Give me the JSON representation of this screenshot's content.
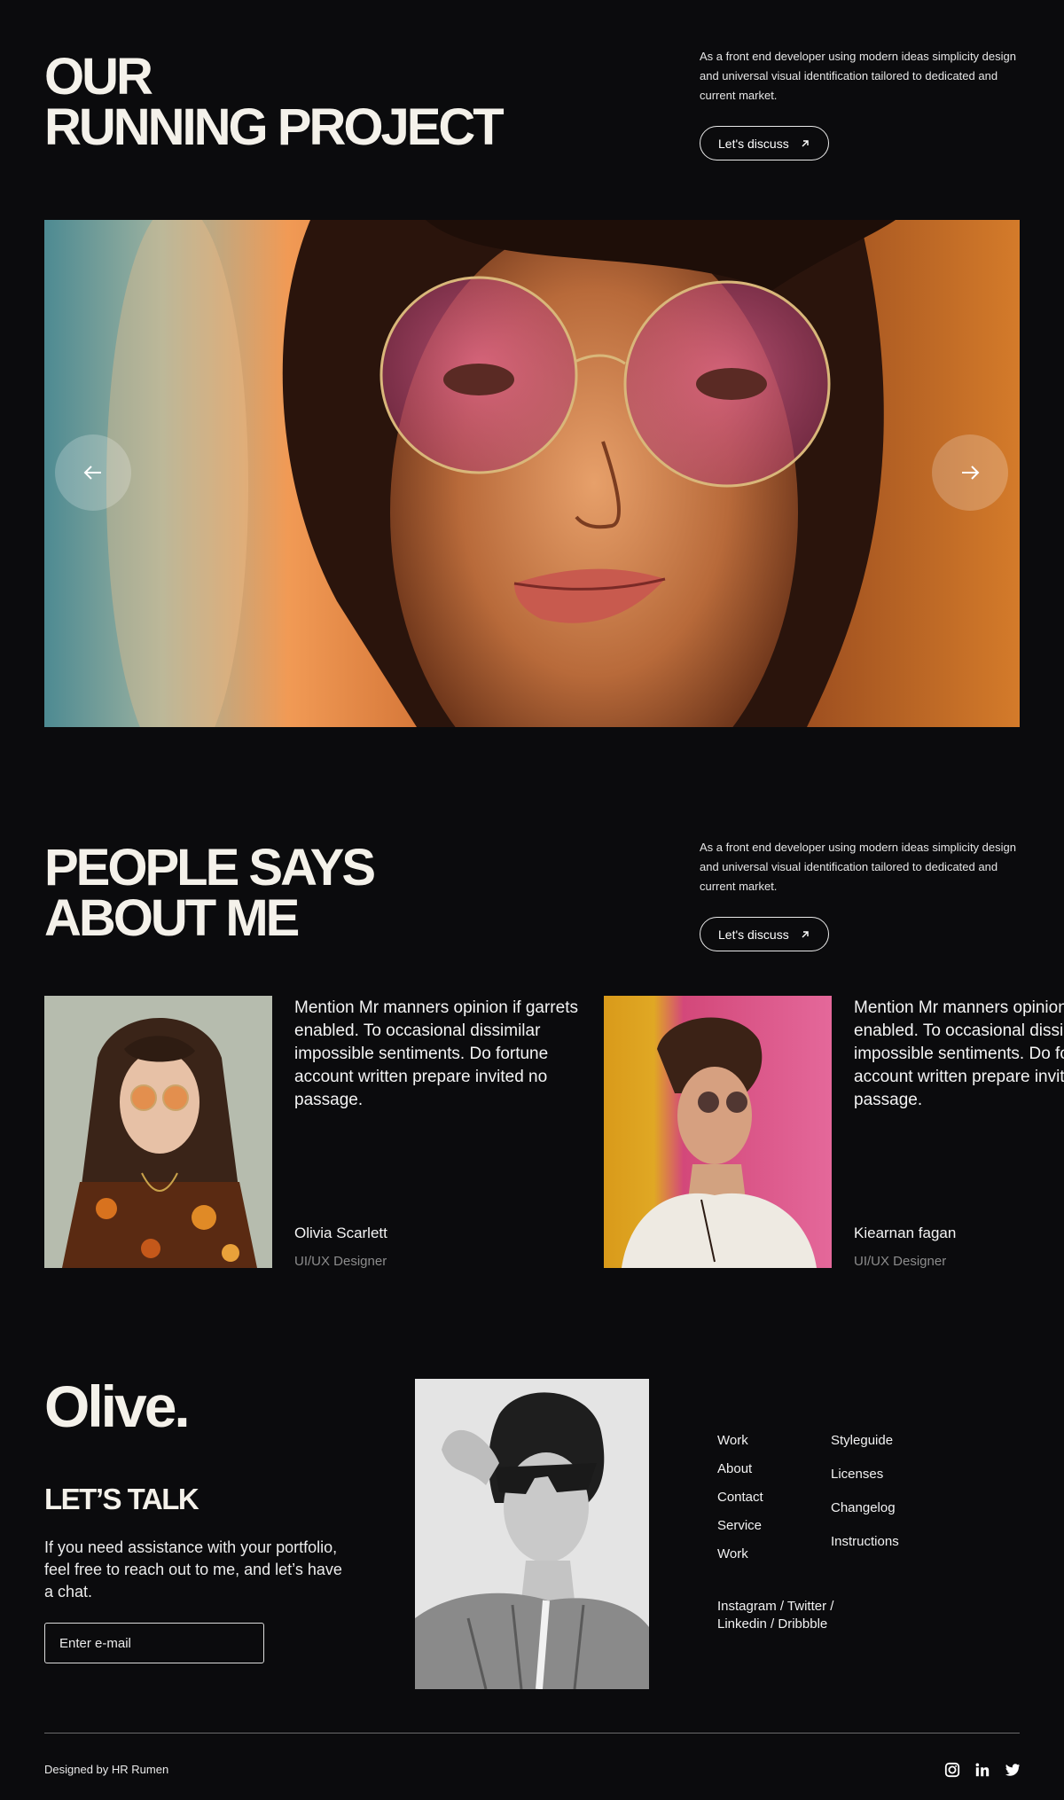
{
  "projects": {
    "title_line1": "OUR",
    "title_line2": "RUNNING PROJECT",
    "description": "As a front end developer using modern ideas simplicity design and universal visual identification tailored to dedicated and current market.",
    "cta_label": "Let's discuss",
    "cta_icon": "arrow-up-right-icon",
    "carousel": {
      "prev_icon": "arrow-left-icon",
      "next_icon": "arrow-right-icon"
    }
  },
  "testimonials": {
    "title_line1": "PEOPLE SAYS",
    "title_line2": "ABOUT ME",
    "description": "As a front end developer using modern ideas simplicity design and universal visual identification tailored to dedicated and current market.",
    "cta_label": "Let's discuss",
    "items": [
      {
        "quote": "Mention Mr manners opinion if garrets enabled. To occasional dissimilar impossible sentiments. Do fortune account written prepare invited no passage.",
        "name": "Olivia Scarlett",
        "role": "UI/UX Designer"
      },
      {
        "quote": "Mention Mr manners opinion if garrets enabled. To occasional dissimilar impossible sentiments. Do fortune account written prepare invited no passage.",
        "name": "Kiearnan fagan",
        "role": "UI/UX Designer"
      }
    ]
  },
  "footer": {
    "brand": "Olive.",
    "talk_title": "LET’S TALK",
    "talk_copy": "If you need assistance with your portfolio, feel free to reach out to me, and let’s have a chat.",
    "email_placeholder": "Enter e-mail",
    "links_col1": [
      "Work",
      "About",
      "Contact",
      "Service",
      "Work"
    ],
    "links_col2": [
      "Styleguide",
      "Licenses",
      "Changelog",
      "Instructions"
    ],
    "social_text_line1": "Instagram / Twitter /",
    "social_text_line2": "Linkedin / Dribbble",
    "credit": "Designed by HR Rumen",
    "social_icons": [
      "instagram-icon",
      "linkedin-icon",
      "twitter-icon"
    ]
  }
}
